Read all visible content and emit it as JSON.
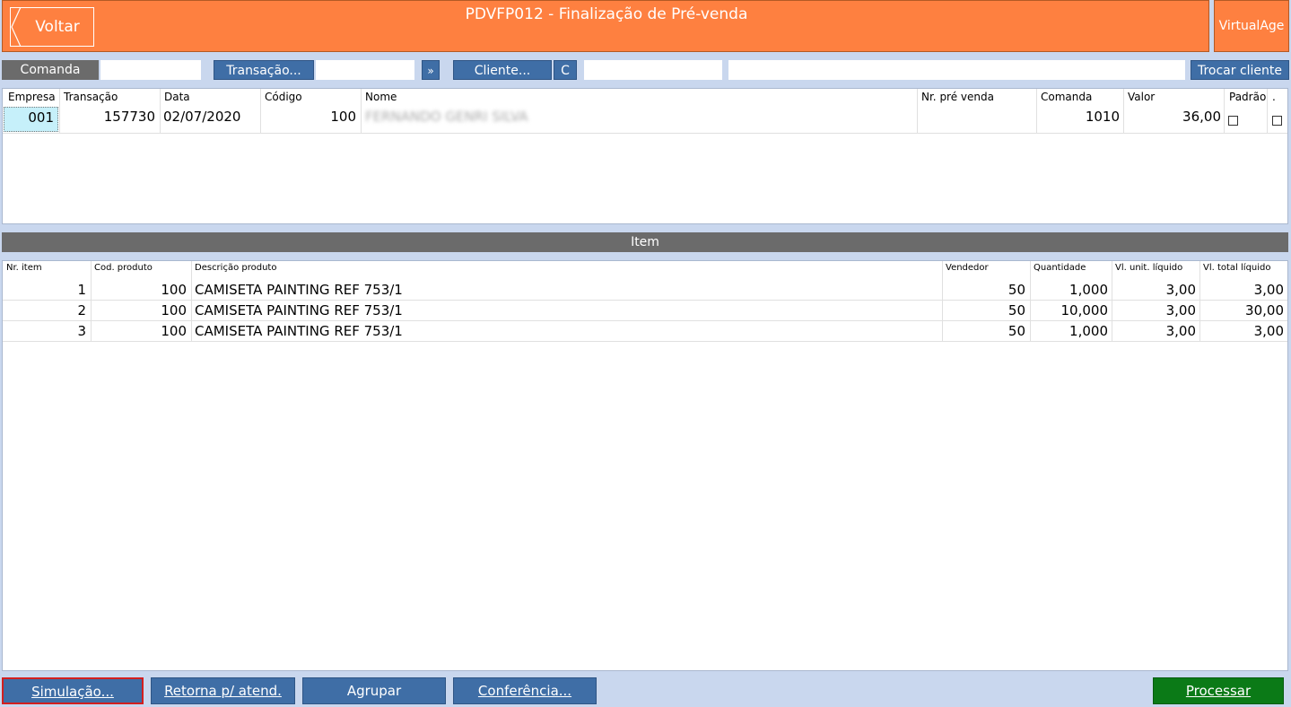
{
  "header": {
    "back_label": "Voltar",
    "title": "PDVFP012 - Finalização de Pré-venda",
    "brand_label": "VirtualAge",
    "accent_color": "#fe8040"
  },
  "toolbar": {
    "comanda_label": "Comanda",
    "comanda_value": "",
    "transacao_button": "Transação...",
    "transacao_value": "",
    "next_button": "»",
    "cliente_button": "Cliente...",
    "c_button": "C",
    "cliente_code_value": "",
    "cliente_name_value": "",
    "trocar_cliente_button": "Trocar cliente"
  },
  "presale_table": {
    "headers": [
      "Empresa",
      "Transação",
      "Data",
      "Código",
      "Nome",
      "Nr. pré venda",
      "Comanda",
      "Valor",
      "Padrão",
      "."
    ],
    "rows": [
      {
        "empresa": "001",
        "transacao": "157730",
        "data": "02/07/2020",
        "codigo": "100",
        "nome": "FERNANDO GENRI SILVA",
        "nr_pre_venda": "",
        "comanda": "1010",
        "valor": "36,00"
      }
    ]
  },
  "item_section": {
    "title": "Item"
  },
  "items_table": {
    "headers": [
      "Nr. item",
      "Cod. produto",
      "Descrição produto",
      "Vendedor",
      "Quantidade",
      "Vl. unit. líquido",
      "Vl. total líquido"
    ],
    "rows": [
      {
        "nr": "1",
        "cod": "100",
        "desc": "CAMISETA PAINTING REF 753/1",
        "vendedor": "50",
        "qtd": "1,000",
        "unit": "3,00",
        "total": "3,00"
      },
      {
        "nr": "2",
        "cod": "100",
        "desc": "CAMISETA PAINTING REF 753/1",
        "vendedor": "50",
        "qtd": "10,000",
        "unit": "3,00",
        "total": "30,00"
      },
      {
        "nr": "3",
        "cod": "100",
        "desc": "CAMISETA PAINTING REF 753/1",
        "vendedor": "50",
        "qtd": "1,000",
        "unit": "3,00",
        "total": "3,00"
      }
    ]
  },
  "footer": {
    "simulacao_button": "Simulação...",
    "retorna_button": "Retorna p/ atend.",
    "agrupar_button": "Agrupar",
    "conferencia_button": "Conferência...",
    "processar_button": "Processar"
  }
}
